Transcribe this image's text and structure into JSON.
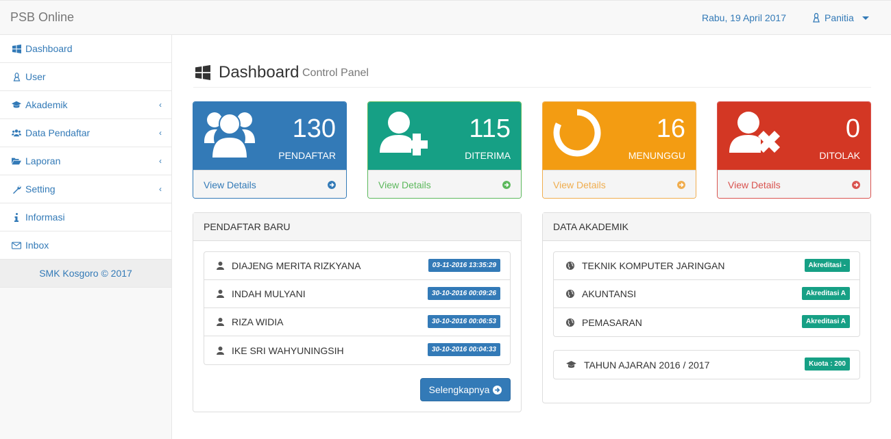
{
  "navbar": {
    "brand": "PSB Online",
    "date": "Rabu, 19 April 2017",
    "user": "Panitia"
  },
  "sidebar": {
    "items": [
      {
        "label": "Dashboard",
        "icon": "windows-icon"
      },
      {
        "label": "User",
        "icon": "user-linux-icon"
      },
      {
        "label": "Akademik",
        "icon": "graduation-cap-icon"
      },
      {
        "label": "Data Pendaftar",
        "icon": "users-icon"
      },
      {
        "label": "Laporan",
        "icon": "folder-open-icon"
      },
      {
        "label": "Setting",
        "icon": "wrench-icon"
      },
      {
        "label": "Informasi",
        "icon": "info-icon"
      },
      {
        "label": "Inbox",
        "icon": "envelope-icon"
      }
    ],
    "footer": "SMK Kosgoro © 2017"
  },
  "header": {
    "title": "Dashboard",
    "subtitle": "Control Panel"
  },
  "stats": [
    {
      "value": "130",
      "label": "PENDAFTAR",
      "link": "View Details",
      "color": "#337ab7"
    },
    {
      "value": "115",
      "label": "DITERIMA",
      "link": "View Details",
      "color": "#16a085"
    },
    {
      "value": "16",
      "label": "MENUNGGU",
      "link": "View Details",
      "color": "#f39c12"
    },
    {
      "value": "0",
      "label": "DITOLAK",
      "link": "View Details",
      "color": "#d33724"
    }
  ],
  "pendaftar_baru": {
    "title": "PENDAFTAR BARU",
    "rows": [
      {
        "name": "DIAJENG MERITA RIZKYANA",
        "time": "03-11-2016 13:35:29"
      },
      {
        "name": "INDAH MULYANI",
        "time": "30-10-2016 00:09:26"
      },
      {
        "name": "RIZA WIDIA",
        "time": "30-10-2016 00:06:53"
      },
      {
        "name": "IKE SRI WAHYUNINGSIH",
        "time": "30-10-2016 00:04:33"
      }
    ],
    "button": "Selengkapnya"
  },
  "data_akademik": {
    "title": "DATA AKADEMIK",
    "jurusan": [
      {
        "name": "TEKNIK KOMPUTER JARINGAN",
        "badge": "Akreditasi -"
      },
      {
        "name": "AKUNTANSI",
        "badge": "Akreditasi A"
      },
      {
        "name": "PEMASARAN",
        "badge": "Akreditasi A"
      }
    ],
    "tahun": {
      "name": "TAHUN AJARAN 2016 / 2017",
      "badge": "Kuota : 200"
    }
  }
}
